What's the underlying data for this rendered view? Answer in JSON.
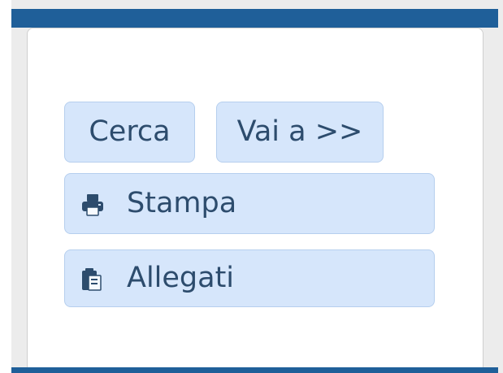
{
  "colors": {
    "header_bar": "#1f5f99",
    "button_bg": "#d6e6fb",
    "button_border": "#b6cfee",
    "button_text": "#2d4c6d"
  },
  "actions": {
    "search_label": "Cerca",
    "goto_label": "Vai a >>",
    "print_label": "Stampa",
    "print_icon": "printer-icon",
    "attachments_label": "Allegati",
    "attachments_icon": "clipboard-icon"
  }
}
